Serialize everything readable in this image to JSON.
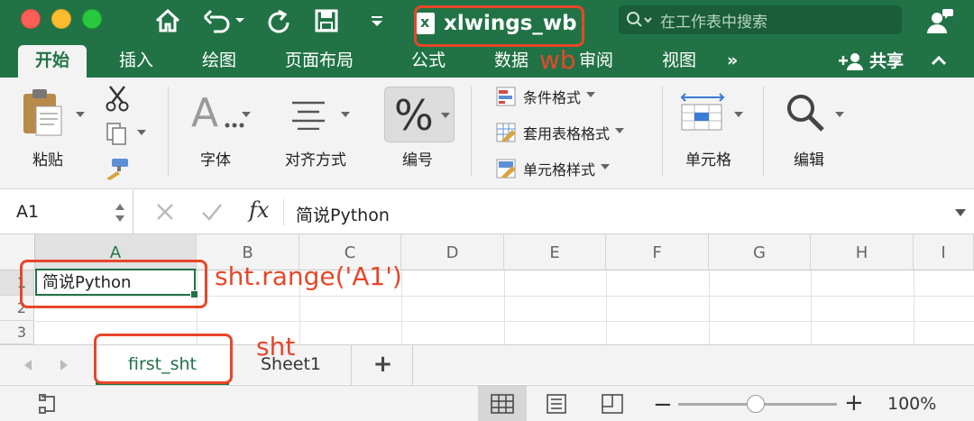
{
  "titlebar": {
    "doc_title": "xlwings_wb",
    "search_placeholder": "在工作表中搜索"
  },
  "tabs": [
    {
      "label": "开始",
      "active": true
    },
    {
      "label": "插入"
    },
    {
      "label": "绘图"
    },
    {
      "label": "页面布局"
    },
    {
      "label": "公式"
    },
    {
      "label": "数据"
    },
    {
      "label": "审阅"
    },
    {
      "label": "视图"
    },
    {
      "label": "»"
    }
  ],
  "share_label": "共享",
  "ribbon": {
    "paste": "粘贴",
    "font": "字体",
    "align": "对齐方式",
    "number": "编号",
    "cond_format": "条件格式",
    "table_format": "套用表格格式",
    "cell_style": "单元格样式",
    "cells": "单元格",
    "edit": "编辑"
  },
  "formula_bar": {
    "name_box": "A1",
    "fx": "fx",
    "content": "简说Python"
  },
  "columns": [
    "A",
    "B",
    "C",
    "D",
    "E",
    "F",
    "G",
    "H",
    "I"
  ],
  "rows": [
    "1",
    "2",
    "3"
  ],
  "cell_a1": "简说Python",
  "sheets": [
    {
      "name": "first_sht",
      "active": true
    },
    {
      "name": "Sheet1"
    }
  ],
  "add_sheet": "+",
  "zoom": "100%",
  "annotations": {
    "wb": "wb",
    "range": "sht.range('A1')",
    "sht": "sht"
  },
  "colors": {
    "excel_green": "#217346",
    "annotation_red": "#e8462a"
  }
}
